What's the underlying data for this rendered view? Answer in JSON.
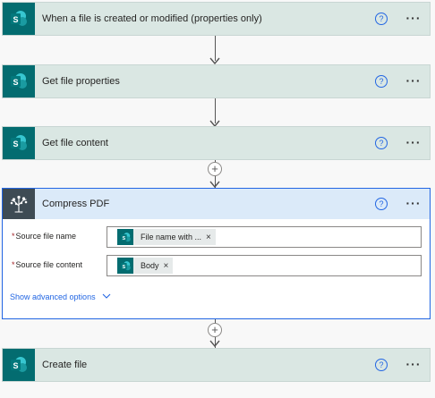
{
  "steps": {
    "trigger": {
      "title": "When a file is created or modified (properties only)"
    },
    "get_properties": {
      "title": "Get file properties"
    },
    "get_content": {
      "title": "Get file content"
    },
    "compress": {
      "title": "Compress PDF",
      "fields": [
        {
          "label": "Source file name",
          "required_mark": "*",
          "token": "File name with ...",
          "token_remove": "×"
        },
        {
          "label": "Source file content",
          "required_mark": "*",
          "token": "Body",
          "token_remove": "×"
        }
      ],
      "advanced_label": "Show advanced options"
    },
    "create_file": {
      "title": "Create file"
    }
  },
  "common": {
    "help_glyph": "?",
    "more_glyph": "···",
    "add_glyph": "+"
  },
  "icons": {
    "sharepoint": "sharepoint-icon",
    "compress": "tree-logo-icon",
    "help": "help-icon",
    "more": "more-icon",
    "add": "add-step-icon",
    "chevron": "chevron-down-icon"
  },
  "colors": {
    "sharepoint": "#036c70",
    "step_header": "#dae7e3",
    "expanded_header": "#dbeaf9",
    "accent": "#2266e3",
    "required": "#a4262c"
  }
}
